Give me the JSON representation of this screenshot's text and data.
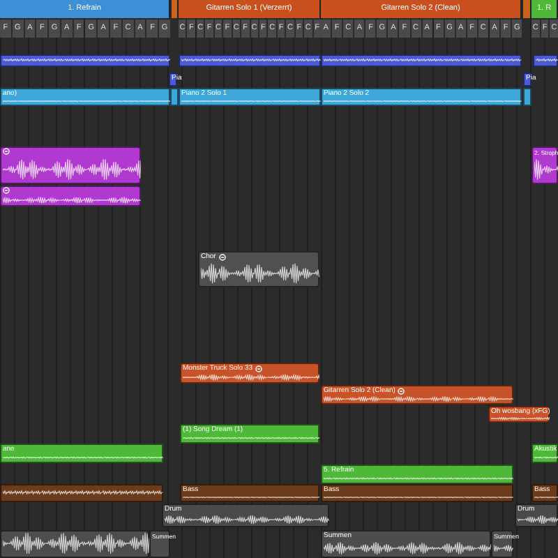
{
  "arrangement": {
    "markers": [
      {
        "label": "1. Refrain",
        "color": "#3d8fd6"
      },
      {
        "color": "#c8641e"
      },
      {
        "label": "Gitarren Solo 1 (Verzerrt)",
        "color": "#c8501e"
      },
      {
        "label": "Gitarren Solo 2 (Clean)",
        "color": "#c8501e"
      },
      {
        "color": "#c8641e"
      },
      {
        "label": "1. R",
        "color": "#4fb83a"
      }
    ],
    "chords": [
      {
        "chords": [
          "F",
          "G",
          "A",
          "F",
          "G",
          "A",
          "F",
          "G",
          "A",
          "F",
          "C",
          "A",
          "F",
          "G"
        ]
      },
      {
        "chords": [
          "C",
          "F",
          "C",
          "F",
          "C",
          "F",
          "C",
          "F",
          "C",
          "F",
          "C",
          "F",
          "C",
          "F",
          "C",
          "F"
        ]
      },
      {
        "chords": [
          "A",
          "F",
          "C",
          "A",
          "F",
          "G",
          "A",
          "F",
          "C",
          "A",
          "F",
          "G",
          "A",
          "F",
          "C",
          "A",
          "F",
          "G"
        ]
      },
      {
        "chords": [
          "C",
          "F",
          "C"
        ]
      }
    ],
    "lanes": [
      {
        "kind": "midi",
        "regions": [
          {
            "color": "#4a5bd4",
            "looped": false
          },
          {
            "color": "#4a5bd4",
            "looped": false
          },
          {
            "color": "#4a5bd4",
            "looped": false
          },
          {
            "color": "#4a5bd4",
            "looped": false
          }
        ]
      },
      {
        "kind": "midi",
        "regions": [
          {
            "label": "Pia",
            "color": "#4a5bd4",
            "looped": false
          },
          {
            "label": "Pia",
            "color": "#4a5bd4",
            "looped": false
          }
        ]
      },
      {
        "kind": "midi",
        "regions": [
          {
            "label": "ano)",
            "color": "#3ea7d8",
            "looped": false
          },
          {
            "color": "#3ea7d8",
            "looped": false
          },
          {
            "label": "Piano 2 Solo 1",
            "color": "#3ea7d8",
            "looped": false
          },
          {
            "label": "Piano 2 Solo 2",
            "color": "#3ea7d8",
            "looped": false
          },
          {
            "color": "#3ea7d8",
            "looped": false
          }
        ]
      },
      {
        "kind": "audio",
        "regions": [
          {
            "color": "#b03ad0",
            "looped": true
          },
          {
            "label": "2. Stroph",
            "color": "#b03ad0",
            "looped": false
          }
        ]
      },
      {
        "kind": "audio",
        "regions": [
          {
            "color": "#b03ad0",
            "looped": true
          }
        ]
      },
      {
        "kind": "audio",
        "regions": [
          {
            "label": "Chor",
            "color": "#505050",
            "looped": true
          }
        ]
      },
      {
        "kind": "audio",
        "regions": [
          {
            "label": "Monster Truck Solo 33",
            "color": "#c6532a",
            "looped": true
          }
        ]
      },
      {
        "kind": "audio",
        "regions": [
          {
            "label": "Gitarren Solo 2 (Clean)",
            "color": "#c6532a",
            "looped": true
          }
        ]
      },
      {
        "kind": "audio",
        "regions": [
          {
            "label": "Oh wosbang (xFG)",
            "color": "#c6532a",
            "looped": false
          }
        ]
      },
      {
        "kind": "midi",
        "regions": [
          {
            "label": "(1) Song Dream (1)",
            "color": "#4fb83a",
            "looped": false
          }
        ]
      },
      {
        "kind": "midi",
        "regions": [
          {
            "label": "ane",
            "color": "#4fb83a",
            "looped": false
          },
          {
            "label": "Akustik",
            "color": "#4fb83a",
            "looped": false
          }
        ]
      },
      {
        "kind": "midi",
        "regions": [
          {
            "label": "5. Refrain",
            "color": "#4fb83a",
            "looped": false
          }
        ]
      },
      {
        "kind": "midi",
        "regions": [
          {
            "color": "#6b3c1c",
            "looped": false
          },
          {
            "label": "Bass",
            "color": "#6b3c1c",
            "looped": false
          },
          {
            "label": "Bass",
            "color": "#6b3c1c",
            "looped": false
          },
          {
            "label": "Bass",
            "color": "#6b3c1c",
            "looped": false
          }
        ]
      },
      {
        "kind": "audio",
        "regions": [
          {
            "label": "Drum",
            "color": "#4a4a4a",
            "looped": false
          },
          {
            "label": "Drum",
            "color": "#4a4a4a",
            "looped": false
          }
        ]
      },
      {
        "kind": "audio",
        "regions": [
          {
            "color": "#4d4d4d",
            "looped": false
          },
          {
            "label": "Summen",
            "color": "#4d4d4d",
            "looped": false
          },
          {
            "label": "Summen",
            "color": "#4d4d4d",
            "looped": false
          },
          {
            "label": "Summen",
            "color": "#4d4d4d",
            "looped": false
          }
        ]
      }
    ]
  }
}
